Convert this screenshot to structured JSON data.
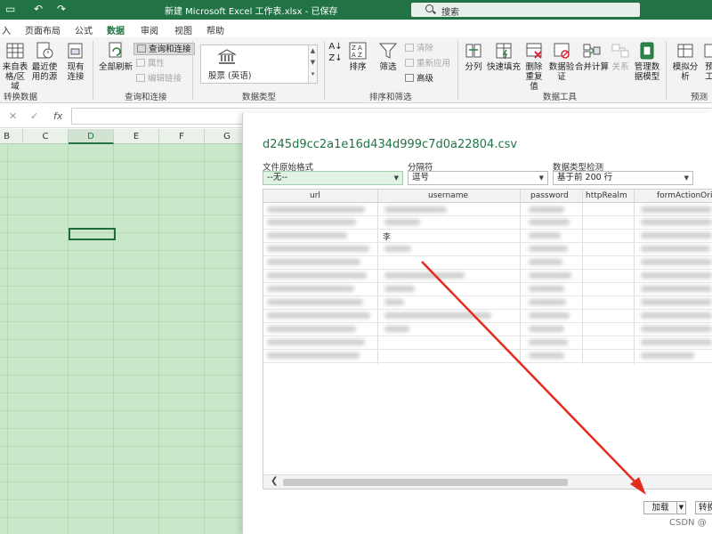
{
  "titlebar": {
    "title": "新建 Microsoft Excel 工作表.xlsx - 已保存",
    "search_placeholder": "搜索"
  },
  "tabs": [
    {
      "label": "入"
    },
    {
      "label": "页面布局"
    },
    {
      "label": "公式"
    },
    {
      "label": "数据",
      "active": true
    },
    {
      "label": "审阅"
    },
    {
      "label": "视图"
    },
    {
      "label": "帮助"
    }
  ],
  "ribbon": {
    "get_transform": {
      "group_label": "转换数据",
      "from_table": "来自表\n格/区域",
      "recent_sources": "最近使\n用的源",
      "existing_connections": "现有\n连接"
    },
    "queries": {
      "group_label": "查询和连接",
      "refresh_all": "全部刷新",
      "queries_connections": "查询和连接",
      "properties": "属性",
      "edit_links": "编辑链接"
    },
    "data_types": {
      "group_label": "数据类型",
      "stocks": "股票 (英语)"
    },
    "sort_filter": {
      "group_label": "排序和筛选",
      "sort": "排序",
      "filter": "筛选",
      "clear": "清除",
      "reapply": "重新应用",
      "advanced": "高级"
    },
    "data_tools": {
      "group_label": "数据工具",
      "text_to_columns": "分列",
      "flash_fill": "快速填充",
      "remove_duplicates": "删除\n重复值",
      "data_validation": "数据验\n证",
      "consolidate": "合并计算",
      "relationships": "关系",
      "manage_model": "管理数\n据模型"
    },
    "forecast": {
      "group_label": "预测",
      "what_if": "模拟分析",
      "forecast_sheet": "预\n工"
    }
  },
  "sheet": {
    "columns": [
      "B",
      "C",
      "D",
      "E",
      "F",
      "G"
    ],
    "active_column": "D"
  },
  "dialog": {
    "file_name": "d245d9cc2a1e16d434d999c7d0a22804.csv",
    "file_origin_label": "文件原始格式",
    "file_origin_value": "--无--",
    "delimiter_label": "分隔符",
    "delimiter_value": "逗号",
    "detection_label": "数据类型检测",
    "detection_value": "基于前 200 行",
    "columns": [
      "url",
      "username",
      "password",
      "httpRealm",
      "formActionOrigin"
    ],
    "visible_cell": "李",
    "load_button": "加载",
    "transform_button": "转换"
  },
  "watermark": "CSDN @",
  "colors": {
    "excel_green": "#217346",
    "annotation_arrow": "#e52a1e"
  }
}
